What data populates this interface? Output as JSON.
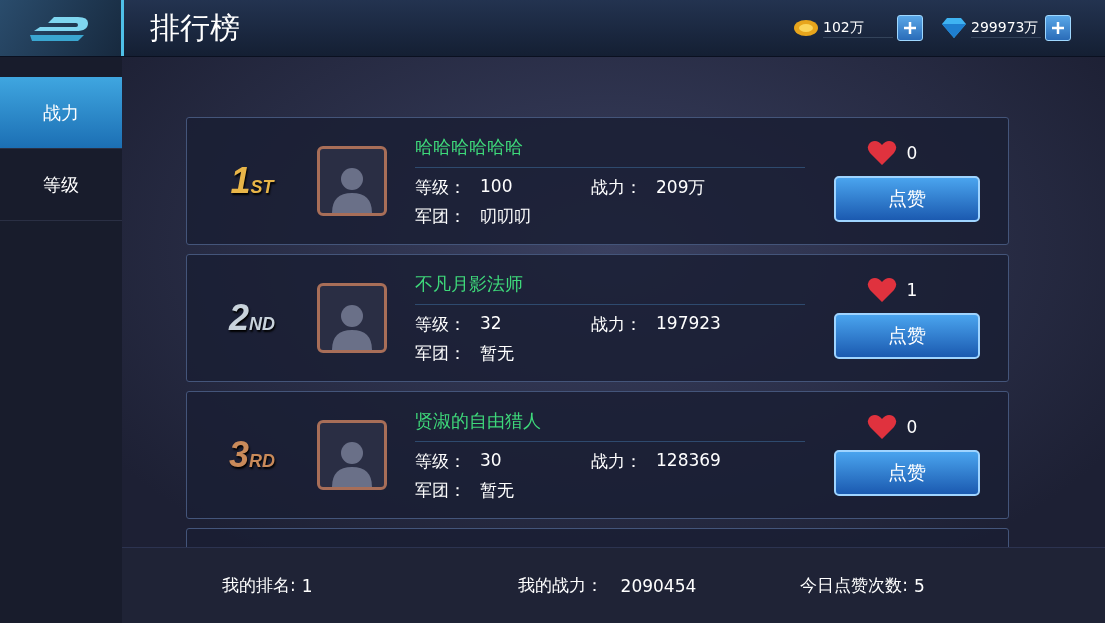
{
  "header": {
    "title": "排行榜",
    "gold": "102万",
    "diamonds": "299973万"
  },
  "sidebar": {
    "items": [
      {
        "label": "战力",
        "selected": true
      },
      {
        "label": "等级",
        "selected": false
      }
    ]
  },
  "rankings": [
    {
      "rank": "1",
      "suffix": "ST",
      "color": "#e8b548",
      "name": "哈哈哈哈哈哈",
      "stats": [
        {
          "label": "等级：",
          "value": "100"
        },
        {
          "label": "战力：",
          "value": "209万"
        },
        {
          "label": "军团：",
          "value": "叨叨叨"
        }
      ],
      "likes": "0",
      "button": "点赞"
    },
    {
      "rank": "2",
      "suffix": "ND",
      "color": "#c9d3dc",
      "name": "不凡月影法师",
      "stats": [
        {
          "label": "等级：",
          "value": "32"
        },
        {
          "label": "战力：",
          "value": "197923"
        },
        {
          "label": "军团：",
          "value": "暂无"
        }
      ],
      "likes": "1",
      "button": "点赞"
    },
    {
      "rank": "3",
      "suffix": "RD",
      "color": "#c98a5a",
      "name": "贤淑的自由猎人",
      "stats": [
        {
          "label": "等级：",
          "value": "30"
        },
        {
          "label": "战力：",
          "value": "128369"
        },
        {
          "label": "军团：",
          "value": "暂无"
        }
      ],
      "likes": "0",
      "button": "点赞"
    }
  ],
  "footer": {
    "my_rank_label": "我的排名:",
    "my_rank": "1",
    "my_power_label": "我的战力：",
    "my_power": "2090454",
    "likes_label": "今日点赞次数:",
    "likes_count": "5"
  }
}
